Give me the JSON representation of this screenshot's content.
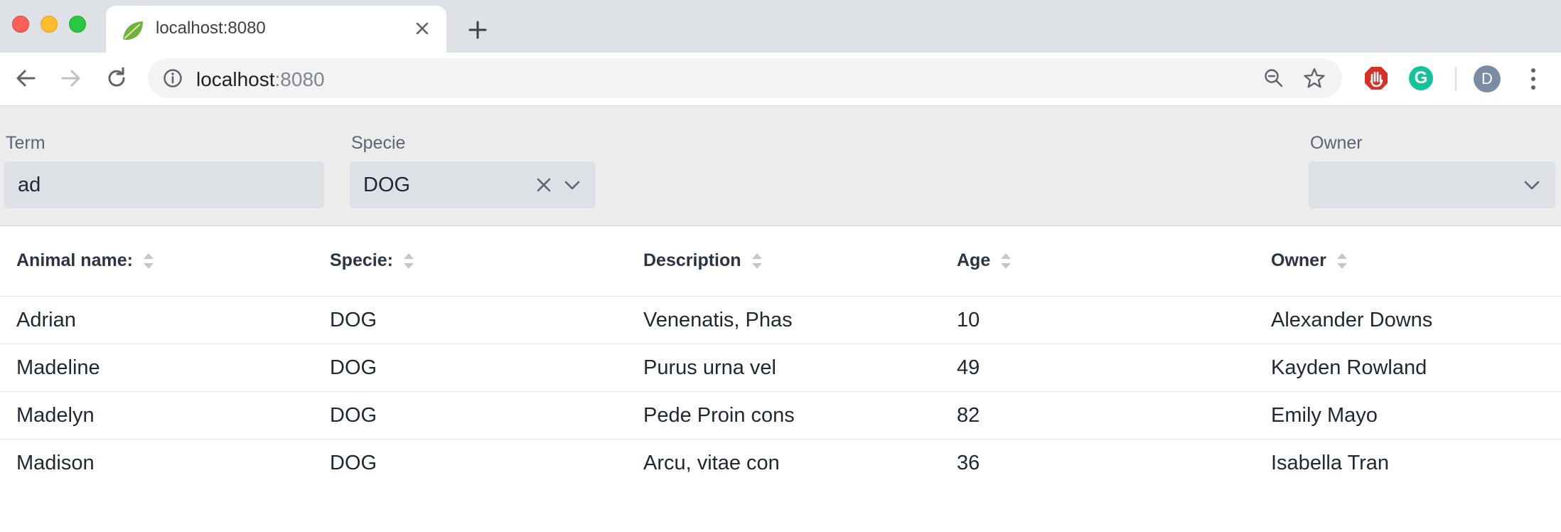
{
  "browser": {
    "tab": {
      "title": "localhost:8080",
      "favicon": "spring-leaf-icon"
    },
    "address": {
      "host": "localhost",
      "port": ":8080"
    },
    "profile_initial": "D",
    "grammarly_letter": "G"
  },
  "filters": {
    "term": {
      "label": "Term",
      "value": "ad"
    },
    "specie": {
      "label": "Specie",
      "value": "DOG"
    },
    "owner": {
      "label": "Owner",
      "value": ""
    }
  },
  "grid": {
    "columns": [
      "Animal name:",
      "Specie:",
      "Description",
      "Age",
      "Owner"
    ],
    "rows": [
      [
        "Adrian",
        "DOG",
        "Venenatis, Phas",
        "10",
        "Alexander Downs"
      ],
      [
        "Madeline",
        "DOG",
        "Purus urna vel",
        "49",
        "Kayden Rowland"
      ],
      [
        "Madelyn",
        "DOG",
        "Pede Proin cons",
        "82",
        "Emily Mayo"
      ],
      [
        "Madison",
        "DOG",
        "Arcu, vitae con",
        "36",
        "Isabella Tran"
      ]
    ]
  },
  "colors": {
    "tabstrip": "#dee1e6",
    "filter_bar": "#ececec",
    "field": "#dde0e4",
    "text": "#1f2733",
    "grammarly": "#15c39a",
    "adblock": "#d93025"
  }
}
